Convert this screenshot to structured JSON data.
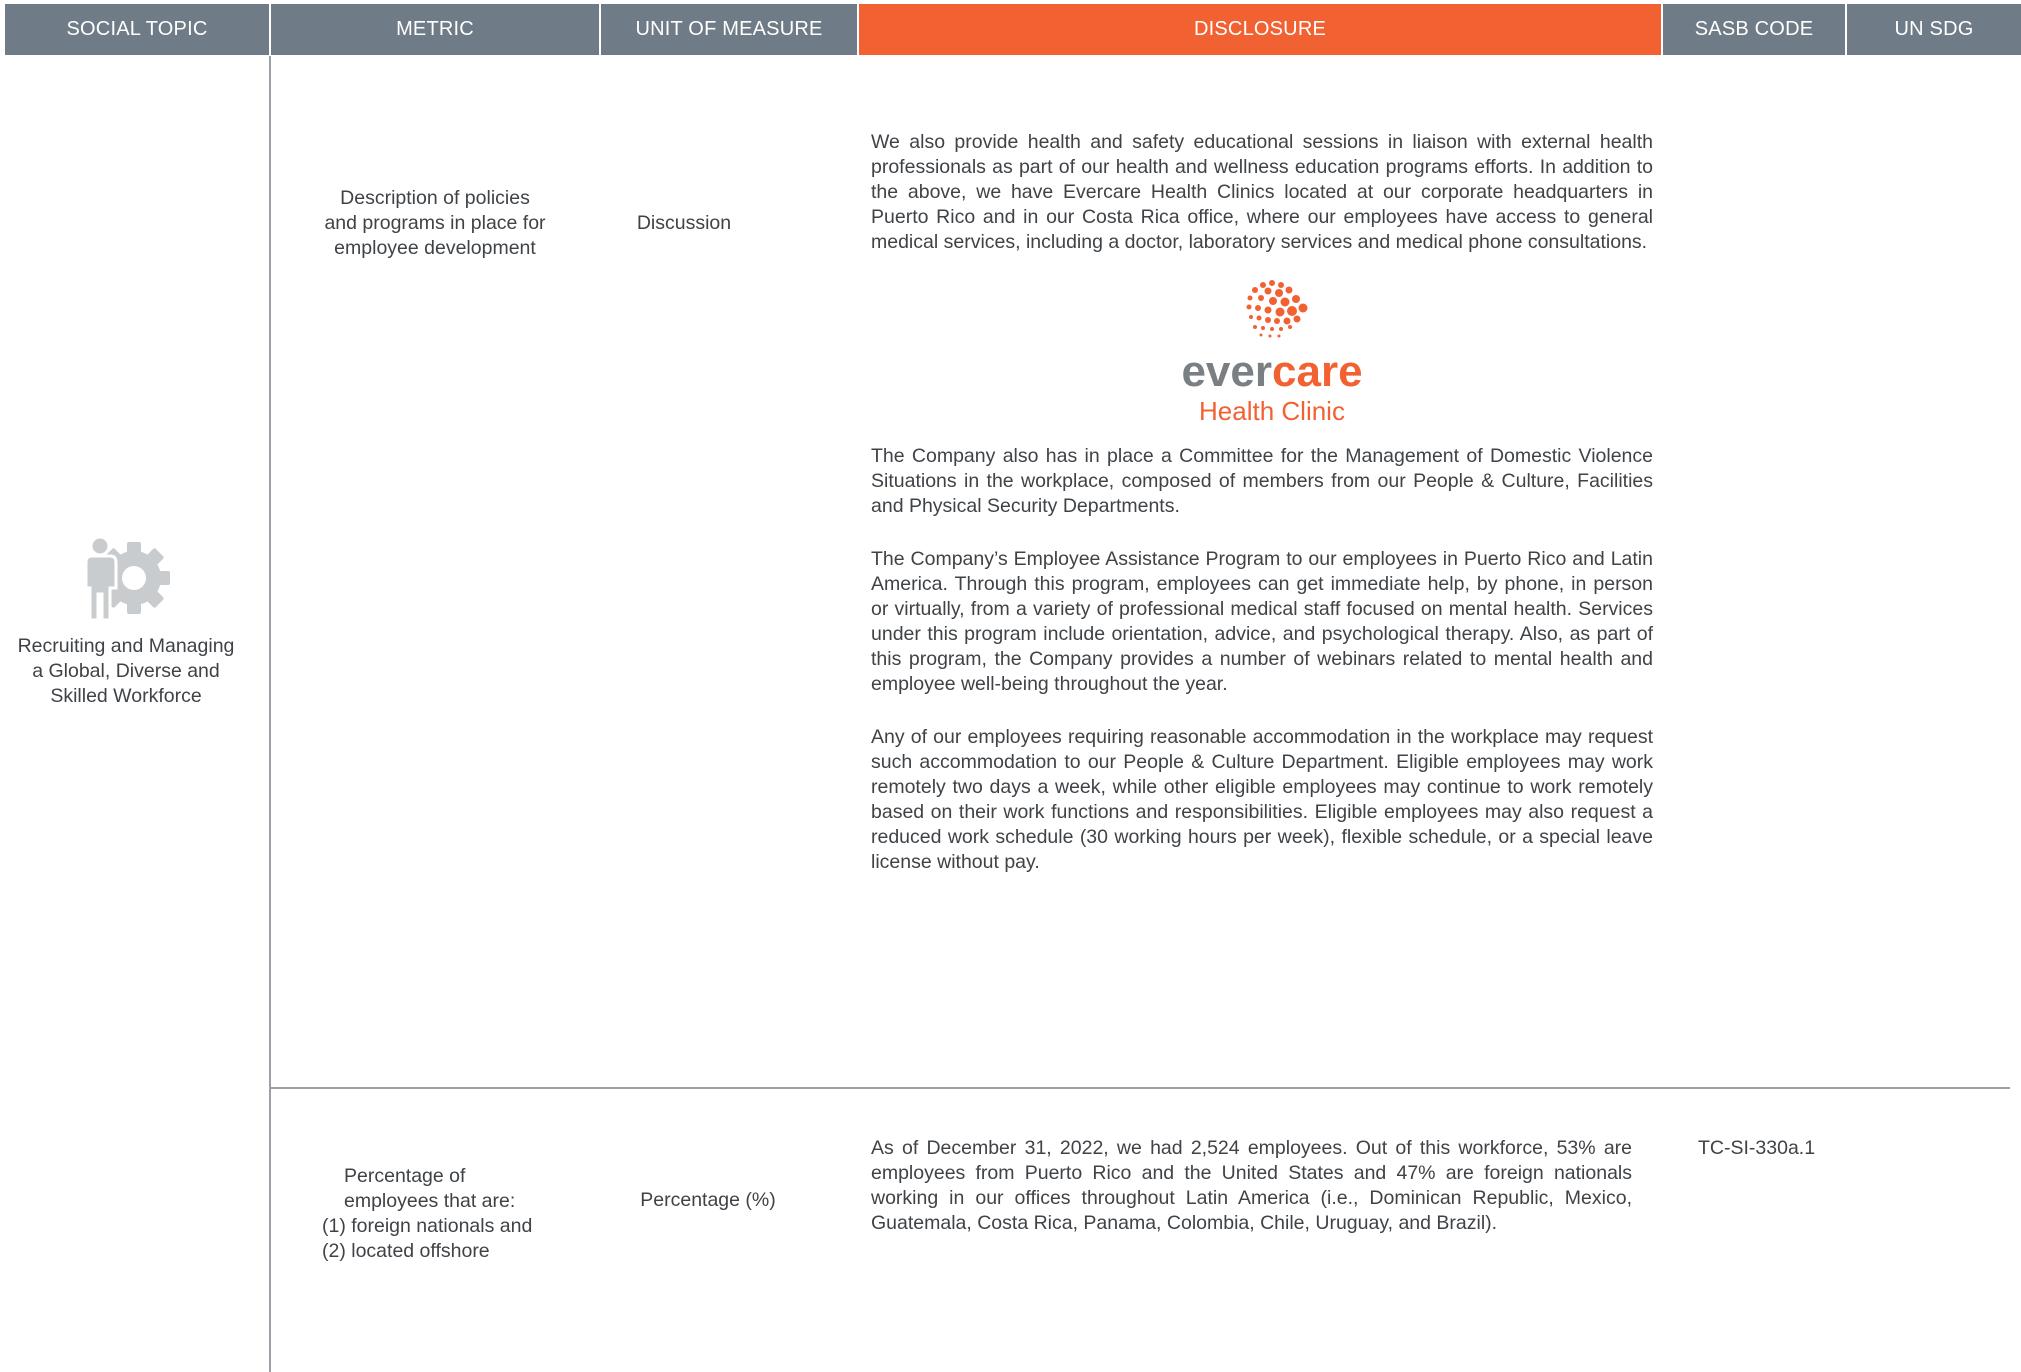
{
  "header": {
    "social_topic": "SOCIAL TOPIC",
    "metric": "METRIC",
    "unit": "UNIT OF MEASURE",
    "disclosure": "DISCLOSURE",
    "sasb": "SASB CODE",
    "sdg": "UN SDG"
  },
  "colors": {
    "header_bg": "#6f7b86",
    "accent": "#f26131",
    "text": "#3f4347",
    "icon": "#c9ccce"
  },
  "topic": {
    "icon": "person-gear-icon",
    "lines": [
      "Recruiting and Managing",
      "a Global, Diverse and",
      "Skilled Workforce"
    ]
  },
  "rows": [
    {
      "metric": [
        "Description of policies",
        "and programs in place for",
        "employee development"
      ],
      "unit": "Discussion",
      "disclosure": {
        "p1": "We also provide health and safety educational sessions in liaison with external health professionals as part of our health and wellness education programs efforts. In addition to the above, we have Evercare Health Clinics located at our corporate headquarters in Puerto Rico and in our Costa Rica office, where our employees have access to general medical services, including a doctor, laboratory services and medical phone consultations.",
        "logo": {
          "word_a": "ever",
          "word_b": "care",
          "tagline": "Health Clinic"
        },
        "p2": "The Company also has in place a Committee for the Management of Domestic Violence Situations in the workplace, composed of members from our People & Culture, Facilities and Physical Security Departments.",
        "p3": "The Company’s Employee Assistance Program to our employees in Puerto Rico and Latin America. Through this program, employees can get immediate help, by phone, in person or virtually, from a variety of professional medical staff focused on mental health. Services under this program include orientation, advice, and psychological therapy. Also, as part of this program, the Company provides a number of webinars related to mental health and employee well-being throughout the year.",
        "p4": "Any of our employees requiring reasonable accommodation in the workplace may request such accommodation to our People & Culture Department. Eligible employees may work remotely two days a week, while other eligible employees may continue to work remotely based on their work functions and responsibilities. Eligible employees may also request a reduced work schedule (30 working hours per week), flexible schedule, or a special leave license without pay."
      },
      "sasb": "",
      "sdg": ""
    },
    {
      "metric": [
        "Percentage of",
        "employees that are:",
        "(1) foreign nationals and",
        "(2) located offshore"
      ],
      "unit": "Percentage (%)",
      "disclosure": {
        "p1": "As of December 31, 2022, we had 2,524 employees. Out of this workforce, 53% are employees from Puerto Rico and the United States and 47% are foreign nationals working in our offices throughout Latin America (i.e., Dominican Republic, Mexico, Guatemala, Costa Rica, Panama, Colombia, Chile, Uruguay, and Brazil)."
      },
      "sasb": "TC-SI-330a.1",
      "sdg": ""
    }
  ]
}
